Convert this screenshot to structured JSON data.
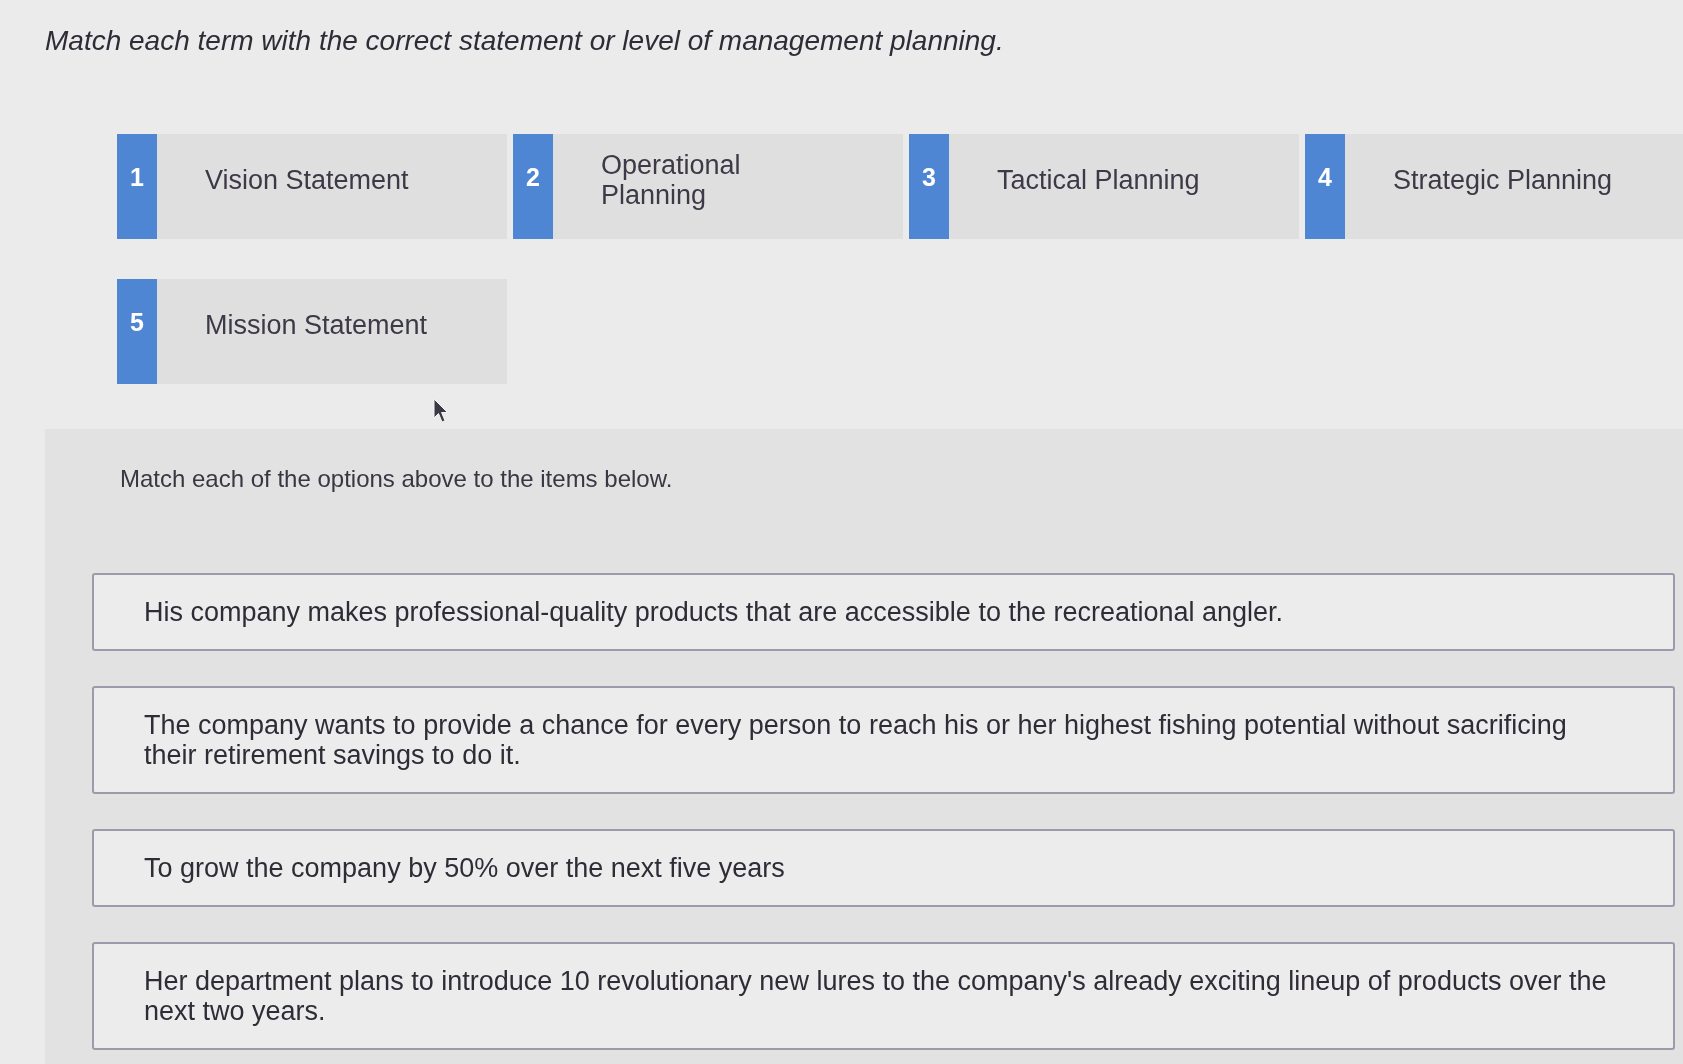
{
  "instruction": "Match each term with the correct statement or level of management planning.",
  "options": [
    {
      "number": "1",
      "label": "Vision Statement"
    },
    {
      "number": "2",
      "label": "Operational Planning"
    },
    {
      "number": "3",
      "label": "Tactical Planning"
    },
    {
      "number": "4",
      "label": "Strategic Planning"
    },
    {
      "number": "5",
      "label": "Mission Statement"
    }
  ],
  "panel": {
    "prompt": "Match each of the options above to the items below.",
    "items": [
      {
        "text": "His company makes professional-quality products that are accessible to the recreational angler."
      },
      {
        "text": "The company wants to provide a chance for every person to reach his or her highest fishing potential without sacrificing their retirement savings to do it."
      },
      {
        "text": "To grow the company by 50% over the next five years"
      },
      {
        "text": "Her department plans to introduce 10 revolutionary new lures to the company's already exciting lineup of products over the next two years."
      }
    ]
  }
}
